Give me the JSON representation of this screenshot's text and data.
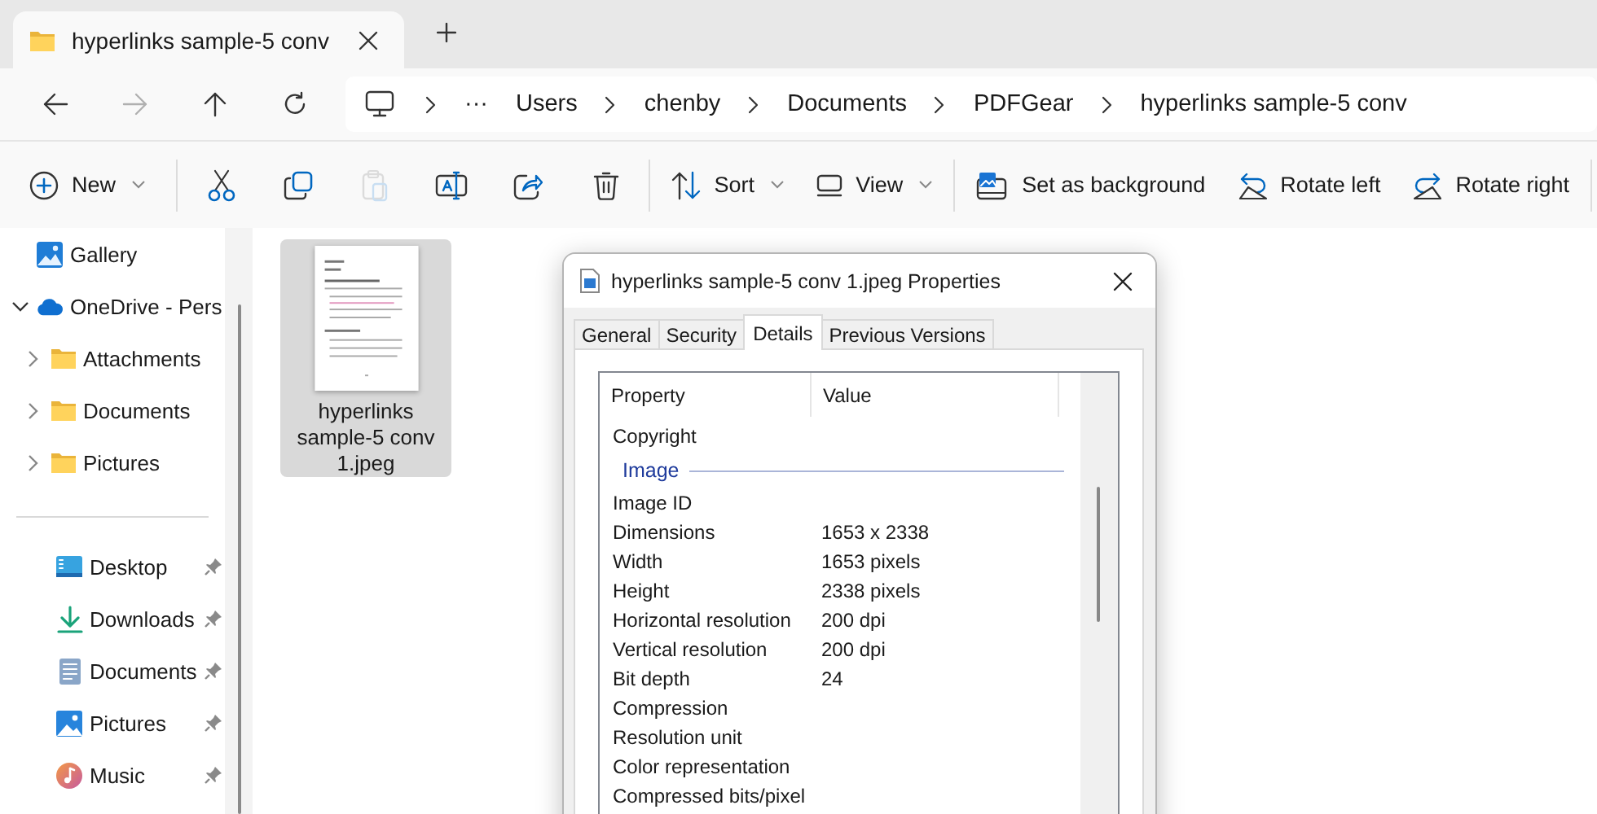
{
  "tabs": [
    {
      "title": "hyperlinks sample-5 conv",
      "selected": true
    }
  ],
  "navigation": {
    "buttons": [
      {
        "kind": "back",
        "disabled": false
      },
      {
        "kind": "forward",
        "disabled": true
      },
      {
        "kind": "up",
        "disabled": false
      },
      {
        "kind": "refresh",
        "disabled": false
      }
    ],
    "breadcrumb": {
      "overflow": "···",
      "items": [
        "Users",
        "chenby",
        "Documents",
        "PDFGear",
        "hyperlinks sample-5 conv"
      ]
    }
  },
  "command_bar": [
    {
      "kind": "new",
      "label": "New",
      "dropdown": true
    },
    {
      "kind": "separator"
    },
    {
      "kind": "cut",
      "disabled": false
    },
    {
      "kind": "copy",
      "disabled": false
    },
    {
      "kind": "paste",
      "disabled": true
    },
    {
      "kind": "rename",
      "disabled": false
    },
    {
      "kind": "share",
      "disabled": false
    },
    {
      "kind": "delete",
      "disabled": false
    },
    {
      "kind": "separator"
    },
    {
      "kind": "sort",
      "label": "Sort",
      "dropdown": true
    },
    {
      "kind": "view",
      "label": "View",
      "dropdown": true
    },
    {
      "kind": "separator"
    },
    {
      "kind": "set_background",
      "label": "Set as background",
      "dropdown": false
    },
    {
      "kind": "rotate_left",
      "label": "Rotate left",
      "dropdown": false
    },
    {
      "kind": "rotate_right",
      "label": "Rotate right",
      "dropdown": false
    },
    {
      "kind": "separator"
    }
  ],
  "sidebar": {
    "items": [
      {
        "kind": "gallery",
        "label": "Gallery"
      },
      {
        "kind": "onedrive",
        "label": "OneDrive - Pers",
        "expanded": true,
        "children": [
          {
            "kind": "folder",
            "label": "Attachments",
            "expanded": false
          },
          {
            "kind": "folder",
            "label": "Documents",
            "expanded": false
          },
          {
            "kind": "folder",
            "label": "Pictures",
            "expanded": false
          }
        ]
      }
    ],
    "pinned": [
      {
        "kind": "desktop",
        "label": "Desktop",
        "pinned": true
      },
      {
        "kind": "downloads",
        "label": "Downloads",
        "pinned": true
      },
      {
        "kind": "documents",
        "label": "Documents",
        "pinned": true
      },
      {
        "kind": "pictures",
        "label": "Pictures",
        "pinned": true
      },
      {
        "kind": "music",
        "label": "Music",
        "pinned": true
      }
    ]
  },
  "files": [
    {
      "name": "hyperlinks sample-5 conv 1.jpeg",
      "selected": true
    }
  ],
  "properties_dialog": {
    "title": "hyperlinks sample-5 conv 1.jpeg Properties",
    "tabs": [
      {
        "label": "General",
        "selected": false
      },
      {
        "label": "Security",
        "selected": false
      },
      {
        "label": "Details",
        "selected": true
      },
      {
        "label": "Previous Versions",
        "selected": false
      }
    ],
    "columns": [
      "Property",
      "Value"
    ],
    "rows": [
      {
        "kind": "property",
        "property": "Copyright"
      },
      {
        "kind": "group",
        "label": "Image"
      },
      {
        "kind": "property",
        "property": "Image ID"
      },
      {
        "kind": "property",
        "property": "Dimensions",
        "value": "1653 x 2338"
      },
      {
        "kind": "property",
        "property": "Width",
        "value": "1653 pixels"
      },
      {
        "kind": "property",
        "property": "Height",
        "value": "2338 pixels"
      },
      {
        "kind": "property",
        "property": "Horizontal resolution",
        "value": "200 dpi"
      },
      {
        "kind": "property",
        "property": "Vertical resolution",
        "value": "200 dpi"
      },
      {
        "kind": "property",
        "property": "Bit depth",
        "value": "24"
      },
      {
        "kind": "property",
        "property": "Compression"
      },
      {
        "kind": "property",
        "property": "Resolution unit"
      },
      {
        "kind": "property",
        "property": "Color representation"
      },
      {
        "kind": "property",
        "property": "Compressed bits/pixel"
      }
    ]
  }
}
